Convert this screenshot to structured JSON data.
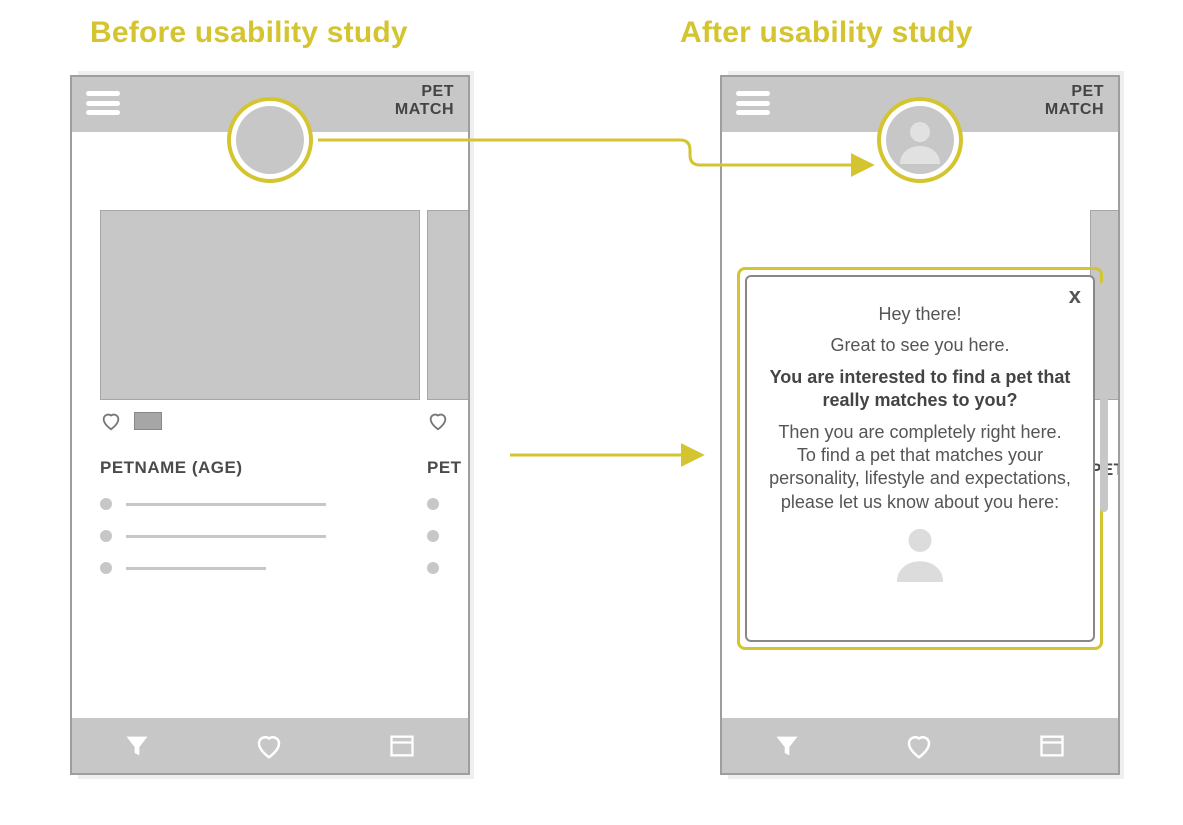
{
  "headings": {
    "before": "Before usability study",
    "after": "After usability study"
  },
  "brand": {
    "line1": "PET",
    "line2": "MATCH"
  },
  "card": {
    "petname": "PETNAME (AGE)",
    "petname_cut": "PET"
  },
  "modal": {
    "close": "x",
    "l1": "Hey there!",
    "l2": "Great to see you here.",
    "l3": "You are interested to find a pet that really matches to you?",
    "l4": "Then you are completely right here. To find a pet that matches your personality, lifestyle and expectations, please let us know about you here:"
  }
}
